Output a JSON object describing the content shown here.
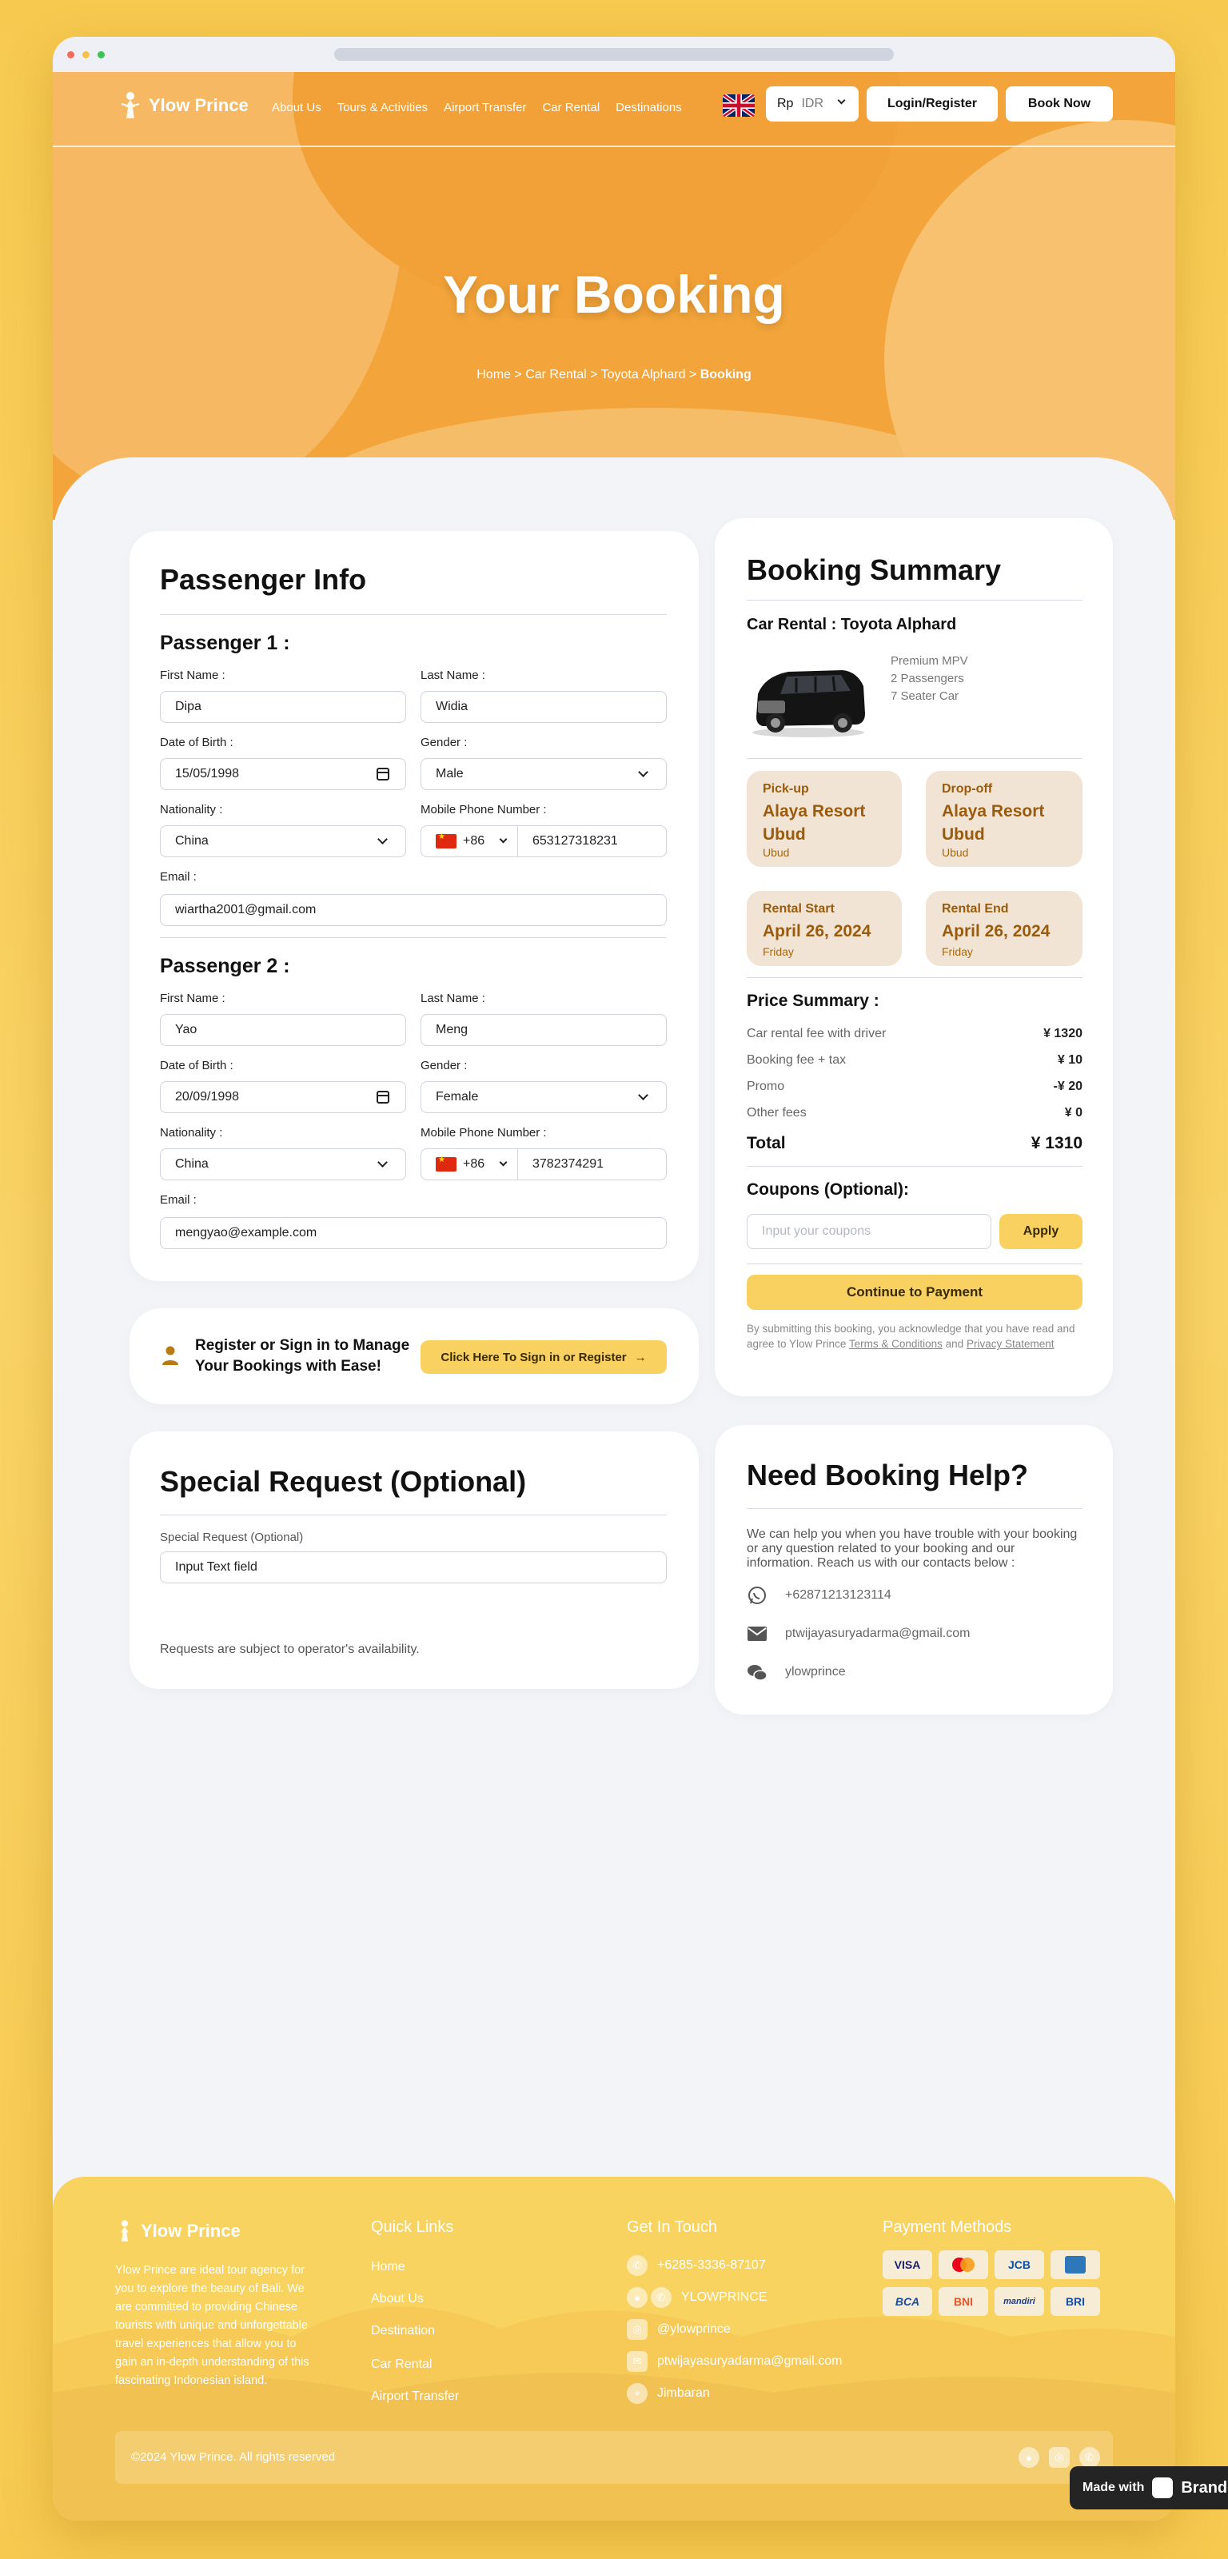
{
  "nav": {
    "brand": "Ylow Prince",
    "links": [
      "About Us",
      "Tours & Activities",
      "Airport Transfer",
      "Car Rental",
      "Destinations"
    ],
    "currency_symbol": "Rp",
    "currency_code": "IDR",
    "login_label": "Login/Register",
    "book_label": "Book Now"
  },
  "hero": {
    "title": "Your Booking",
    "breadcrumb": [
      "Home",
      "Car Rental",
      "Toyota Alphard",
      "Booking"
    ]
  },
  "passenger_info": {
    "title": "Passenger Info",
    "passengers": [
      {
        "heading": "Passenger 1 :",
        "first_name_label": "First Name :",
        "first_name": "Dipa",
        "last_name_label": "Last Name :",
        "last_name": "Widia",
        "dob_label": "Date of Birth :",
        "dob": "15/05/1998",
        "gender_label": "Gender :",
        "gender": "Male",
        "nationality_label": "Nationality :",
        "nationality": "China",
        "phone_label": "Mobile Phone Number :",
        "phone_code": "+86",
        "phone": "653127318231",
        "email_label": "Email :",
        "email": "wiartha2001@gmail.com"
      },
      {
        "heading": "Passenger 2 :",
        "first_name_label": "First Name :",
        "first_name": "Yao",
        "last_name_label": "Last Name :",
        "last_name": "Meng",
        "dob_label": "Date of Birth :",
        "dob": "20/09/1998",
        "gender_label": "Gender :",
        "gender": "Female",
        "nationality_label": "Nationality :",
        "nationality": "China",
        "phone_label": "Mobile Phone Number :",
        "phone_code": "+86",
        "phone": "3782374291",
        "email_label": "Email :",
        "email": "mengyao@example.com"
      }
    ]
  },
  "signin_banner": {
    "text": "Register or Sign in to Manage Your Bookings with Ease!",
    "button": "Click Here To Sign in or Register"
  },
  "special_request": {
    "title": "Special Request (Optional)",
    "field_label": "Special Request (Optional)",
    "placeholder": "Input Text field",
    "note": "Requests are subject to operator's availability."
  },
  "summary": {
    "title": "Booking Summary",
    "product": "Car Rental : Toyota Alphard",
    "features": [
      "Premium MPV",
      "2 Passengers",
      "7 Seater Car"
    ],
    "pickup": {
      "label": "Pick-up",
      "value": "Alaya Resort Ubud",
      "sub": "Ubud"
    },
    "dropoff": {
      "label": "Drop-off",
      "value": "Alaya Resort Ubud",
      "sub": "Ubud"
    },
    "start": {
      "label": "Rental Start",
      "value": "April 26, 2024",
      "sub": "Friday"
    },
    "end": {
      "label": "Rental End",
      "value": "April 26, 2024",
      "sub": "Friday"
    },
    "price_title": "Price Summary :",
    "prices": [
      {
        "label": "Car rental fee with driver",
        "value": "¥ 1320"
      },
      {
        "label": "Booking fee + tax",
        "value": "¥ 10"
      },
      {
        "label": "Promo",
        "value": "-¥ 20"
      },
      {
        "label": "Other fees",
        "value": "¥ 0"
      }
    ],
    "total_label": "Total",
    "total_value": "¥ 1310",
    "coupon_title": "Coupons (Optional):",
    "coupon_placeholder": "Input your coupons",
    "apply_label": "Apply",
    "continue_label": "Continue to Payment",
    "disclaimer_pre": "By submitting this booking, you acknowledge that you have read and agree to Ylow Prince",
    "terms": "Terms & Conditions",
    "and": "and",
    "privacy": "Privacy Statement"
  },
  "help": {
    "title": "Need Booking Help?",
    "text": "We can help you when you have trouble with your booking or any question related to your booking and our information. Reach us with our contacts below :",
    "phone": "+62871213123114",
    "email": "ptwijayasuryadarma@gmail.com",
    "wechat": "ylowprince"
  },
  "footer": {
    "brand": "Ylow Prince",
    "about": "Ylow Prince are ideal tour agency for you to explore the beauty of Bali. We are committed to providing Chinese tourists with unique and unforgettable travel experiences that allow you to gain an in-depth understanding of this fascinating Indonesian island.",
    "quick_links_title": "Quick Links",
    "quick_links": [
      "Home",
      "About Us",
      "Destination",
      "Car Rental",
      "Airport Transfer"
    ],
    "contact_title": "Get In Touch",
    "contacts": [
      "+6285-3336-87107",
      "YLOWPRINCE",
      "@ylowprince",
      "ptwijayasuryadarma@gmail.com",
      "Jimbaran"
    ],
    "payment_title": "Payment Methods",
    "payments": [
      "VISA",
      "",
      "JCB",
      "",
      "BCA",
      "BNI",
      "mandiri",
      "BRI"
    ],
    "copyright": "©2024 Ylow Prince. All rights reserved"
  },
  "made_with": {
    "label": "Made with",
    "brand": "Brand"
  }
}
